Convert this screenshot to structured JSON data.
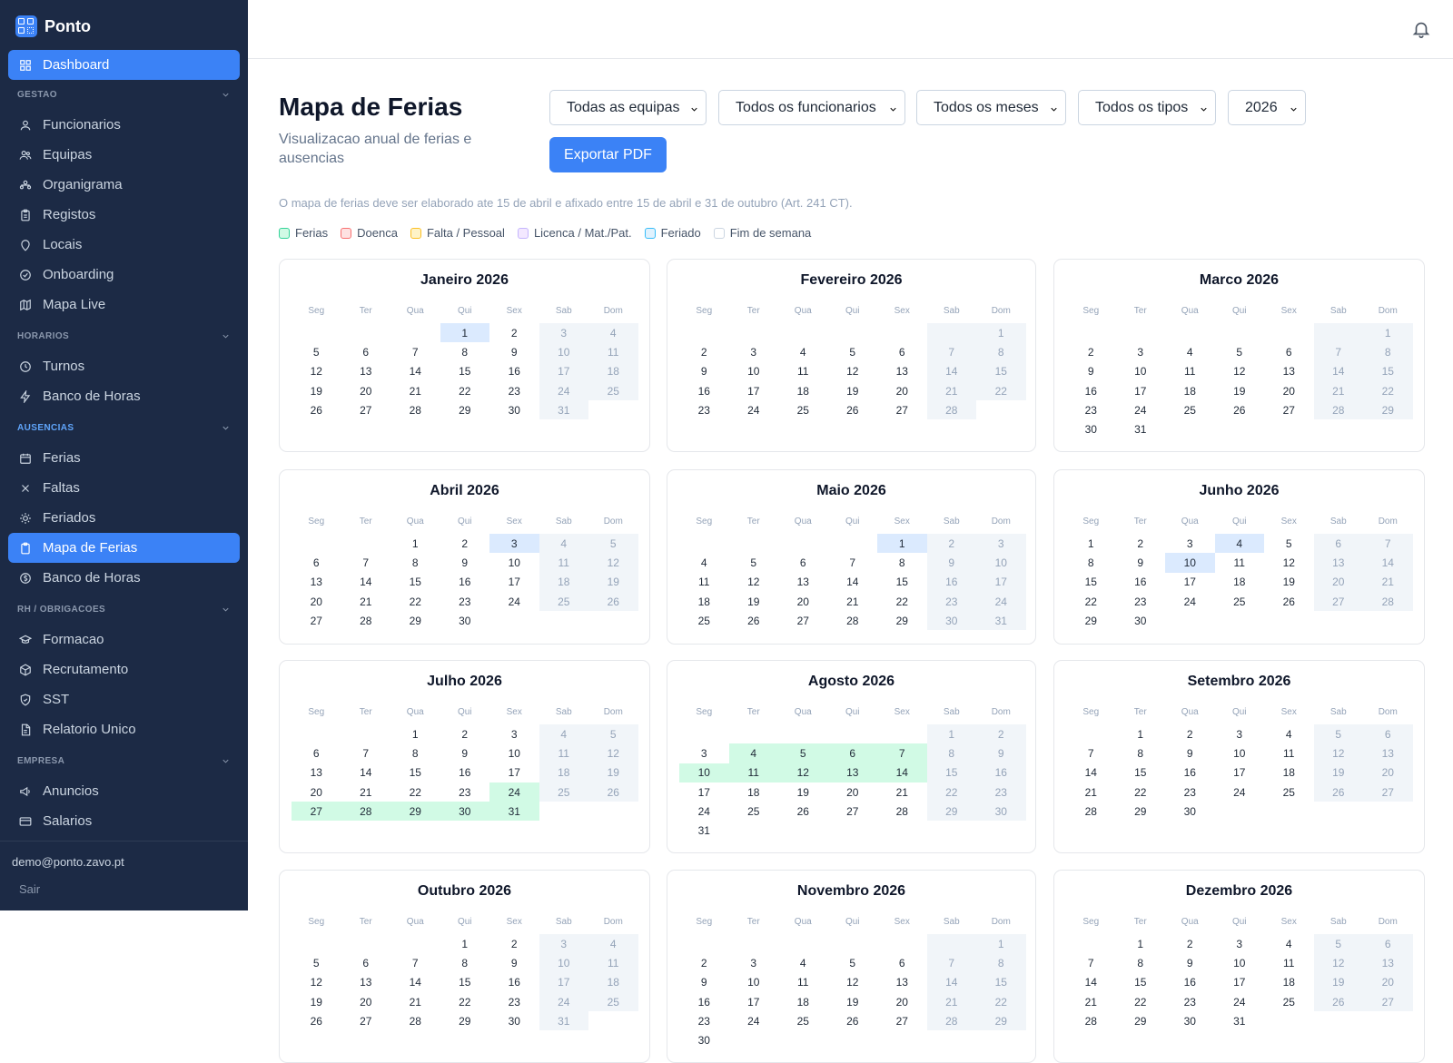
{
  "app": {
    "name": "Ponto"
  },
  "sidebar": {
    "dashboard": "Dashboard",
    "sections": [
      {
        "label": "GESTAO",
        "items": [
          "Funcionarios",
          "Equipas",
          "Organigrama",
          "Registos",
          "Locais",
          "Onboarding",
          "Mapa Live"
        ]
      },
      {
        "label": "HORARIOS",
        "items": [
          "Turnos",
          "Banco de Horas"
        ]
      },
      {
        "label": "AUSENCIAS",
        "items": [
          "Ferias",
          "Faltas",
          "Feriados",
          "Mapa de Ferias",
          "Banco de Horas"
        ]
      },
      {
        "label": "RH / OBRIGACOES",
        "items": [
          "Formacao",
          "Recrutamento",
          "SST",
          "Relatorio Unico"
        ]
      },
      {
        "label": "EMPRESA",
        "items": [
          "Anuncios",
          "Salarios"
        ]
      }
    ],
    "user_email": "demo@ponto.zavo.pt",
    "logout": "Sair"
  },
  "page": {
    "title": "Mapa de Ferias",
    "subtitle": "Visualizacao anual de ferias e ausencias",
    "filters": {
      "team": "Todas as equipas",
      "employee": "Todos os funcionarios",
      "month": "Todos os meses",
      "type": "Todos os tipos",
      "year": "2026"
    },
    "export_button": "Exportar PDF",
    "note": "O mapa de ferias deve ser elaborado ate 15 de abril e afixado entre 15 de abril e 31 de outubro (Art. 241 CT).",
    "legend": [
      {
        "label": "Ferias",
        "color": "#34d399",
        "fill": "#d1fae5"
      },
      {
        "label": "Doenca",
        "color": "#f87171",
        "fill": "#fee2e2"
      },
      {
        "label": "Falta / Pessoal",
        "color": "#fbbf24",
        "fill": "#fef3c7"
      },
      {
        "label": "Licenca / Mat./Pat.",
        "color": "#c4b5fd",
        "fill": "#f3e8ff"
      },
      {
        "label": "Feriado",
        "color": "#38bdf8",
        "fill": "#e0f2fe"
      },
      {
        "label": "Fim de semana",
        "color": "#cbd5e1",
        "fill": "#ffffff"
      }
    ]
  },
  "calendar": {
    "weekdays": [
      "Seg",
      "Ter",
      "Qua",
      "Qui",
      "Sex",
      "Sab",
      "Dom"
    ],
    "months": [
      {
        "title": "Janeiro 2026",
        "offset": 3,
        "days": 31,
        "holidays": [
          1
        ],
        "vacation": []
      },
      {
        "title": "Fevereiro 2026",
        "offset": 6,
        "days": 28,
        "holidays": [],
        "vacation": []
      },
      {
        "title": "Marco 2026",
        "offset": 6,
        "days": 31,
        "holidays": [],
        "vacation": []
      },
      {
        "title": "Abril 2026",
        "offset": 2,
        "days": 30,
        "holidays": [
          3
        ],
        "vacation": []
      },
      {
        "title": "Maio 2026",
        "offset": 4,
        "days": 31,
        "holidays": [
          1
        ],
        "vacation": []
      },
      {
        "title": "Junho 2026",
        "offset": 0,
        "days": 30,
        "holidays": [
          4,
          10
        ],
        "vacation": []
      },
      {
        "title": "Julho 2026",
        "offset": 2,
        "days": 31,
        "holidays": [],
        "vacation": [
          24,
          27,
          28,
          29,
          30,
          31
        ]
      },
      {
        "title": "Agosto 2026",
        "offset": 5,
        "days": 31,
        "holidays": [],
        "vacation": [
          4,
          5,
          6,
          7,
          10,
          11,
          12,
          13,
          14
        ]
      },
      {
        "title": "Setembro 2026",
        "offset": 1,
        "days": 30,
        "holidays": [],
        "vacation": []
      },
      {
        "title": "Outubro 2026",
        "offset": 3,
        "days": 31,
        "holidays": [],
        "vacation": []
      },
      {
        "title": "Novembro 2026",
        "offset": 6,
        "days": 30,
        "holidays": [],
        "vacation": []
      },
      {
        "title": "Dezembro 2026",
        "offset": 1,
        "days": 31,
        "holidays": [],
        "vacation": []
      }
    ]
  }
}
